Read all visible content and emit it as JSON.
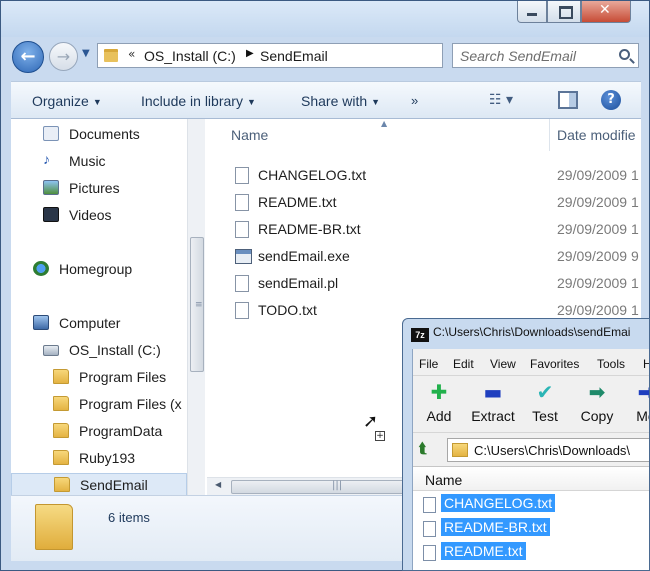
{
  "explorer": {
    "breadcrumb": {
      "overflow": "«",
      "drive": "OS_Install (C:)",
      "folder": "SendEmail"
    },
    "search": {
      "placeholder": "Search SendEmail"
    },
    "commands": {
      "organize": "Organize",
      "include_in_library": "Include in library",
      "share_with": "Share with",
      "more": "»"
    },
    "nav_pane": {
      "items": [
        {
          "label": "Documents",
          "icon": "documents-icon"
        },
        {
          "label": "Music",
          "icon": "music-icon"
        },
        {
          "label": "Pictures",
          "icon": "pictures-icon"
        },
        {
          "label": "Videos",
          "icon": "videos-icon"
        },
        {
          "label": "Homegroup",
          "icon": "homegroup-icon"
        },
        {
          "label": "Computer",
          "icon": "computer-icon"
        },
        {
          "label": "OS_Install (C:)",
          "icon": "drive-icon"
        },
        {
          "label": "Program Files",
          "icon": "folder-icon"
        },
        {
          "label": "Program Files (x",
          "icon": "folder-icon"
        },
        {
          "label": "ProgramData",
          "icon": "folder-icon"
        },
        {
          "label": "Ruby193",
          "icon": "folder-icon"
        },
        {
          "label": "SendEmail",
          "icon": "folder-icon",
          "selected": true
        }
      ]
    },
    "file_list": {
      "columns": {
        "name": "Name",
        "date_modified": "Date modifie"
      },
      "files": [
        {
          "name": "CHANGELOG.txt",
          "date": "29/09/2009 1",
          "icon": "text-file-icon"
        },
        {
          "name": "README.txt",
          "date": "29/09/2009 1",
          "icon": "text-file-icon"
        },
        {
          "name": "README-BR.txt",
          "date": "29/09/2009 1",
          "icon": "text-file-icon"
        },
        {
          "name": "sendEmail.exe",
          "date": "29/09/2009 9",
          "icon": "exe-file-icon"
        },
        {
          "name": "sendEmail.pl",
          "date": "29/09/2009 1",
          "icon": "file-icon"
        },
        {
          "name": "TODO.txt",
          "date": "29/09/2009 1",
          "icon": "text-file-icon"
        }
      ]
    },
    "details": {
      "item_count": "6 items"
    }
  },
  "sevenzip": {
    "title": "C:\\Users\\Chris\\Downloads\\sendEmai",
    "logo": "7z",
    "menu": [
      "File",
      "Edit",
      "View",
      "Favorites",
      "Tools",
      "H"
    ],
    "toolbar": [
      {
        "label": "Add",
        "icon": "add-icon",
        "color": "#22b14c"
      },
      {
        "label": "Extract",
        "icon": "extract-icon",
        "color": "#1f3fbf"
      },
      {
        "label": "Test",
        "icon": "test-icon",
        "color": "#2bb5b5"
      },
      {
        "label": "Copy",
        "icon": "copy-icon",
        "color": "#1f8a6a"
      },
      {
        "label": "Mo",
        "icon": "move-icon",
        "color": "#1f3fbf"
      }
    ],
    "path": "C:\\Users\\Chris\\Downloads\\",
    "list_header": "Name",
    "files": [
      "CHANGELOG.txt",
      "README-BR.txt",
      "README.txt"
    ],
    "selection_color": "#3399ff"
  }
}
